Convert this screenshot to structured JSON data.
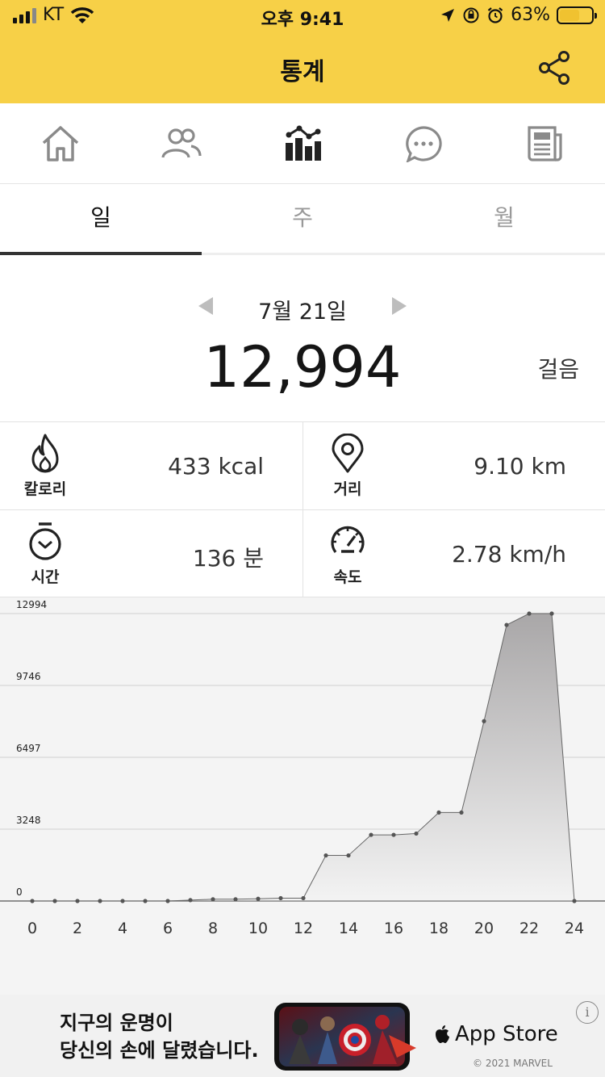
{
  "status": {
    "carrier": "KT",
    "time": "오후 9:41",
    "battery": "63%",
    "battery_level": 0.63
  },
  "header": {
    "title": "통계"
  },
  "nav": {
    "items": [
      {
        "icon": "home-icon"
      },
      {
        "icon": "friends-icon"
      },
      {
        "icon": "stats-icon"
      },
      {
        "icon": "chat-icon"
      },
      {
        "icon": "news-icon"
      }
    ]
  },
  "tabs": [
    {
      "label": "일",
      "active": true
    },
    {
      "label": "주",
      "active": false
    },
    {
      "label": "월",
      "active": false
    }
  ],
  "summary": {
    "date": "7월 21일",
    "steps": "12,994",
    "steps_unit": "걸음"
  },
  "stats": {
    "calories": {
      "label": "칼로리",
      "value": "433 kcal"
    },
    "distance": {
      "label": "거리",
      "value": "9.10 km"
    },
    "time": {
      "label": "시간",
      "value": "136 분"
    },
    "speed": {
      "label": "속도",
      "value": "2.78 km/h"
    }
  },
  "colors": {
    "accent": "#f7d047",
    "chart_fill_top": "#a9a7a8",
    "chart_fill_bottom": "#f3f3f3",
    "chart_line": "#666666"
  },
  "chart_data": {
    "type": "area",
    "x": [
      0,
      1,
      2,
      3,
      4,
      5,
      6,
      7,
      8,
      9,
      10,
      11,
      12,
      13,
      14,
      15,
      16,
      17,
      18,
      19,
      20,
      21,
      22,
      23,
      24
    ],
    "values": [
      0,
      0,
      0,
      0,
      0,
      0,
      0,
      40,
      80,
      80,
      100,
      130,
      130,
      2060,
      2060,
      2990,
      2990,
      3050,
      4000,
      4000,
      8130,
      12480,
      12994,
      12994,
      0
    ],
    "xticks": [
      0,
      2,
      4,
      6,
      8,
      10,
      12,
      14,
      16,
      18,
      20,
      22,
      24
    ],
    "yticks": [
      0,
      3248,
      6497,
      9746,
      12994
    ],
    "ylim": [
      0,
      12994
    ],
    "grid": true
  },
  "ad": {
    "line1": "지구의 운명이",
    "line2": "당신의 손에 달렸습니다.",
    "store": "App Store",
    "copyright": "© 2021 MARVEL",
    "info": "i"
  }
}
